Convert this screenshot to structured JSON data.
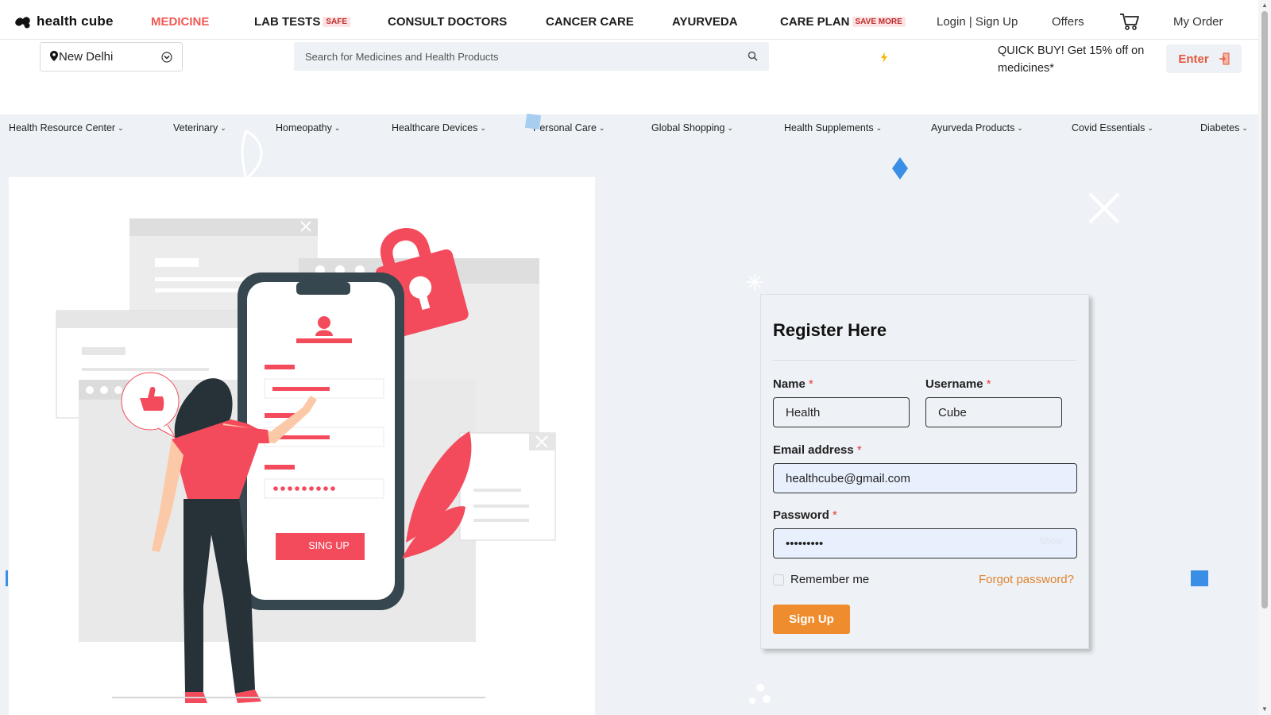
{
  "brand": {
    "name": "health cube"
  },
  "nav": {
    "items": [
      {
        "label": "MEDICINE",
        "badge": ""
      },
      {
        "label": "LAB TESTS",
        "badge": "SAFE"
      },
      {
        "label": "CONSULT DOCTORS",
        "badge": ""
      },
      {
        "label": "CANCER CARE",
        "badge": ""
      },
      {
        "label": "AYURVEDA",
        "badge": ""
      },
      {
        "label": "CARE PLAN",
        "badge": "SAVE MORE"
      }
    ],
    "login": "Login | Sign Up",
    "offers": "Offers",
    "my_order": "My Order"
  },
  "location": {
    "value": "New Delhi"
  },
  "search": {
    "placeholder": "Search for Medicines and Health Products"
  },
  "promo": {
    "text": "QUICK BUY! Get 15% off on medicines*",
    "enter_label": "Enter"
  },
  "categories": [
    "Health Resource Center",
    "Veterinary",
    "Homeopathy",
    "Healthcare Devices",
    "Personal Care",
    "Global Shopping",
    "Health Supplements",
    "Ayurveda Products",
    "Covid Essentials",
    "Diabetes"
  ],
  "illustration": {
    "button_label": "SING UP"
  },
  "register": {
    "title": "Register Here",
    "name_label": "Name",
    "name_value": "Health",
    "username_label": "Username",
    "username_value": "Cube",
    "email_label": "Email address",
    "email_value": "healthcube@gmail.com",
    "password_label": "Password",
    "password_value": "123456789",
    "show_label": "Show",
    "remember_label": "Remember me",
    "remember_checked": false,
    "forgot_label": "Forgot password?",
    "submit_label": "Sign Up",
    "required_mark": "*"
  },
  "colors": {
    "accent_red": "#f05a54",
    "button_orange": "#ef8c2d",
    "link_orange": "#e0832e",
    "page_bg": "#eef2f6",
    "illustration_red": "#f44b5c",
    "illustration_dark": "#263238"
  },
  "icons": {
    "logo": "health-cube-logo-icon",
    "cart": "cart-icon",
    "pin": "location-pin-icon",
    "chevron": "chevron-down-icon",
    "search": "search-icon",
    "bolt": "lightning-icon",
    "door": "door-enter-icon"
  }
}
